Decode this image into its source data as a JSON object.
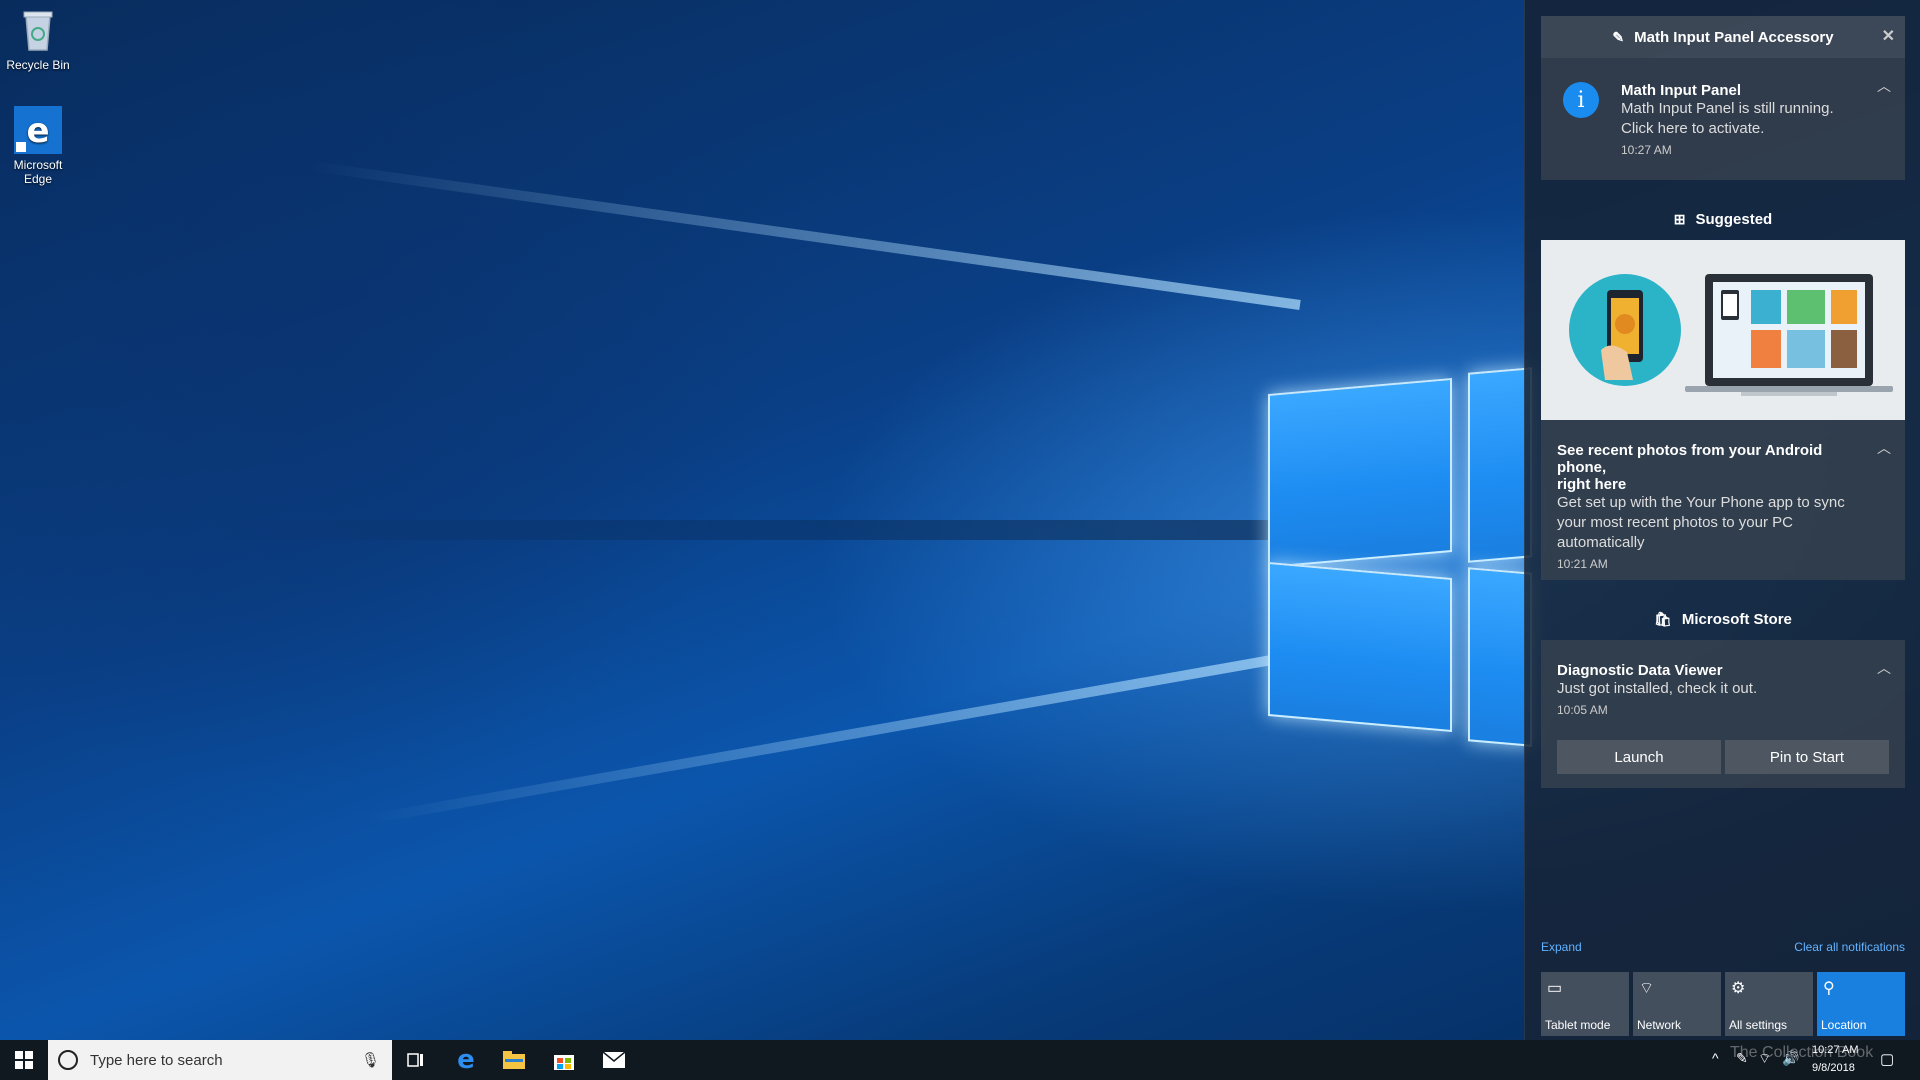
{
  "desktop": {
    "icons": [
      {
        "label": "Recycle Bin",
        "icon": "recycle-bin-icon"
      },
      {
        "label": "Microsoft Edge",
        "icon": "edge-icon"
      }
    ]
  },
  "action_center": {
    "group1": {
      "app": "Math Input Panel Accessory",
      "notification": {
        "title": "Math Input Panel",
        "body_line1": "Math Input Panel is still running.",
        "body_line2": "Click here to activate.",
        "time": "10:27 AM"
      }
    },
    "group2": {
      "app": "Suggested",
      "notification": {
        "title_line1": "See recent photos from your Android phone,",
        "title_line2": "right here",
        "body_line1": "Get set up with the Your Phone app to sync",
        "body_line2": "your most recent photos to your PC",
        "body_line3": "automatically",
        "time": "10:21 AM"
      }
    },
    "group3": {
      "app": "Microsoft Store",
      "notification": {
        "title": "Diagnostic Data Viewer",
        "body": "Just got installed, check it out.",
        "time": "10:05 AM",
        "buttons": [
          "Launch",
          "Pin to Start"
        ]
      }
    },
    "expand_label": "Expand",
    "clear_label": "Clear all notifications",
    "quick_actions": [
      {
        "label": "Tablet mode",
        "active": false
      },
      {
        "label": "Network",
        "active": false
      },
      {
        "label": "All settings",
        "active": false
      },
      {
        "label": "Location",
        "active": true
      }
    ],
    "accent_color": "#1a80e0"
  },
  "taskbar": {
    "search_placeholder": "Type here to search",
    "pinned": [
      "task-view-icon",
      "edge-icon",
      "file-explorer-icon",
      "store-icon",
      "mail-icon"
    ],
    "clock_time": "10:27 AM",
    "clock_date": "9/8/2018"
  },
  "watermark": "The Collection Book"
}
